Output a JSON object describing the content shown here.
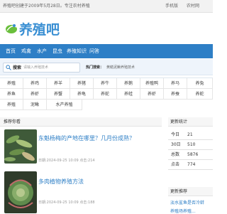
{
  "topbar": {
    "notice": "养殖吧创建于2009年5月28日。专注农村养殖",
    "links": [
      "手机版",
      "农村网"
    ]
  },
  "brand": {
    "logo_text": "养殖吧"
  },
  "nav": {
    "items": [
      "首页",
      "鸡禽",
      "水产",
      "昆虫",
      "养殖知识",
      "问答"
    ]
  },
  "search": {
    "label": "搜索",
    "placeholder": "请输入养殖技术",
    "hot_label": "热门搜索：",
    "hot_terms": "黄鳝泥鳅养殖技术"
  },
  "categories": [
    [
      "养殖",
      "养鸡",
      "养羊",
      "养猪",
      "养牛",
      "养鹅",
      "养殖鸭",
      "养马",
      "养兔"
    ],
    [
      "养鱼",
      "养虾",
      "养蟹",
      "养龟",
      "养蛇",
      "养蛙",
      "养虾",
      "养蚕",
      "养蛇"
    ],
    [
      "养殖",
      "泥鳅",
      "水产养殖"
    ]
  ],
  "recommend": {
    "title": "推荐你看",
    "articles": [
      {
        "title": "东魁杨梅的产地在哪里？几月份成熟？",
        "meta": "日期:2024-09-25 10:09  点击:214"
      },
      {
        "title": "多肉植物养殖方法",
        "meta": "日期:2024-09-25 10:09  点击:188"
      }
    ]
  },
  "stats": {
    "title": "更新统计",
    "rows": [
      {
        "k": "今日",
        "v": "21"
      },
      {
        "k": "30日",
        "v": "510"
      },
      {
        "k": "总数",
        "v": "5876"
      },
      {
        "k": "点击",
        "v": "774"
      }
    ]
  },
  "side_recommend": {
    "title": "更新推荐",
    "items": [
      "淡水鲨鱼是否冷蚌",
      "养殖场养殖..."
    ]
  }
}
